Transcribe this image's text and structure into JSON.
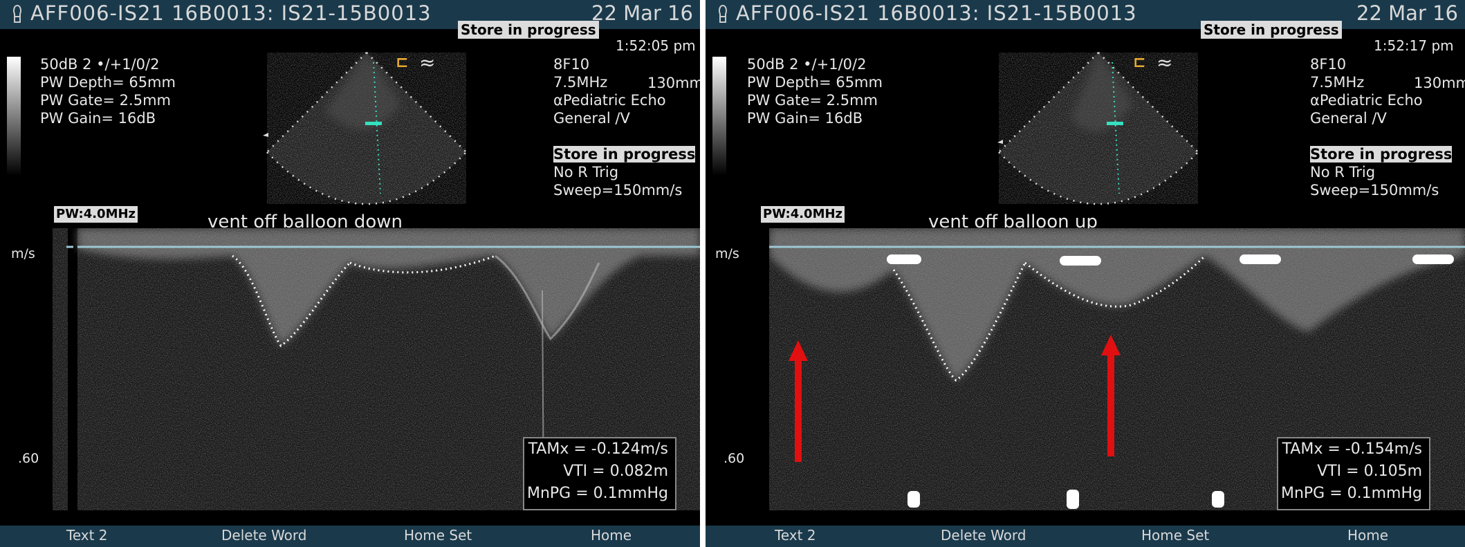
{
  "colors": {
    "titlebar": "#1a3a4c",
    "arrow": "#e01010",
    "baseline": "#9cc9d4",
    "sample_gate": "#35e0c0",
    "orientation_marker": "#e4a11b"
  },
  "left": {
    "title": "AFF006-IS21 16B0013: IS21-15B0013",
    "date": "22 Mar 16",
    "store_top": "Store in progress",
    "time": "1:52:05 pm",
    "params": [
      "50dB 2 •/+1/0/2",
      "PW Depth= 65mm",
      "PW Gate= 2.5mm",
      "PW Gain= 16dB"
    ],
    "probe": {
      "model": "8F10",
      "freq": "7.5MHz",
      "depth": "130mm",
      "preset": "αPediatric Echo",
      "mode": "General /V",
      "store": "Store in progress",
      "trigger": "No R Trig",
      "sweep": "Sweep=150mm/s"
    },
    "pw_freq": "PW:4.0MHz",
    "comment": "vent off balloon down",
    "axis_unit": "m/s",
    "axis_mark": ".60",
    "measurements": [
      "TAMx = -0.124m/s",
      "VTI = 0.082m",
      "MnPG = 0.1mmHg"
    ],
    "softkeys": [
      "Text 2",
      "Delete Word",
      "Home Set",
      "Home"
    ]
  },
  "right": {
    "title": "AFF006-IS21 16B0013: IS21-15B0013",
    "date": "22 Mar 16",
    "store_top": "Store in progress",
    "time": "1:52:17 pm",
    "params": [
      "50dB 2 •/+1/0/2",
      "PW Depth= 65mm",
      "PW Gate= 2.5mm",
      "PW Gain= 16dB"
    ],
    "probe": {
      "model": "8F10",
      "freq": "7.5MHz",
      "depth": "130mm",
      "preset": "αPediatric Echo",
      "mode": "General /V",
      "store": "Store in progress",
      "trigger": "No R Trig",
      "sweep": "Sweep=150mm/s"
    },
    "pw_freq": "PW:4.0MHz",
    "comment": "vent off balloon up",
    "axis_unit": "m/s",
    "axis_mark": ".60",
    "measurements": [
      "TAMx = -0.154m/s",
      "VTI = 0.105m",
      "MnPG = 0.1mmHg"
    ],
    "softkeys": [
      "Text 2",
      "Delete Word",
      "Home Set",
      "Home"
    ]
  }
}
